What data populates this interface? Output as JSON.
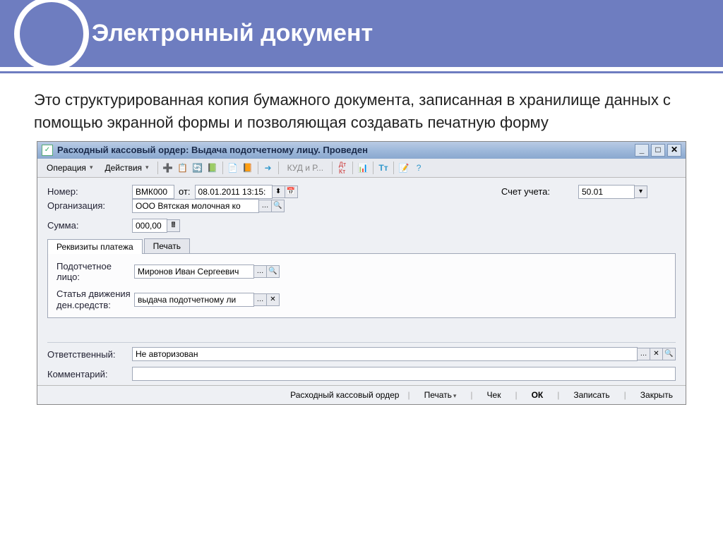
{
  "slide": {
    "title": "Электронный документ",
    "description": "Это структурированная копия бумажного документа, записанная в хранилище данных с помощью экранной формы и позволяющая создавать печатную форму"
  },
  "window": {
    "title": "Расходный кассовый ордер: Выдача подотчетному лицу. Проведен"
  },
  "toolbar": {
    "operation": "Операция",
    "actions": "Действия",
    "kudir": "КУД и Р..."
  },
  "form": {
    "number_label": "Номер:",
    "number_value": "ВМК000",
    "date_label": "от:",
    "date_value": "08.01.2011 13:15:",
    "account_label": "Счет учета:",
    "account_value": "50.01",
    "org_label": "Организация:",
    "org_value": "ООО Вятская молочная ко",
    "sum_label": "Сумма:",
    "sum_value": "000,00"
  },
  "tabs": {
    "tab1": "Реквизиты платежа",
    "tab2": "Печать"
  },
  "payment": {
    "person_label": "Подотчетное лицо:",
    "person_value": "Миронов Иван Сергеевич",
    "flow_label": "Статья движения ден.средств:",
    "flow_value": "выдача подотчетному ли"
  },
  "footer_fields": {
    "resp_label": "Ответственный:",
    "resp_value": "Не авторизован",
    "comment_label": "Комментарий:",
    "comment_value": ""
  },
  "bottombar": {
    "doc_name": "Расходный кассовый ордер",
    "print": "Печать",
    "check": "Чек",
    "ok": "ОК",
    "save": "Записать",
    "close": "Закрыть"
  }
}
